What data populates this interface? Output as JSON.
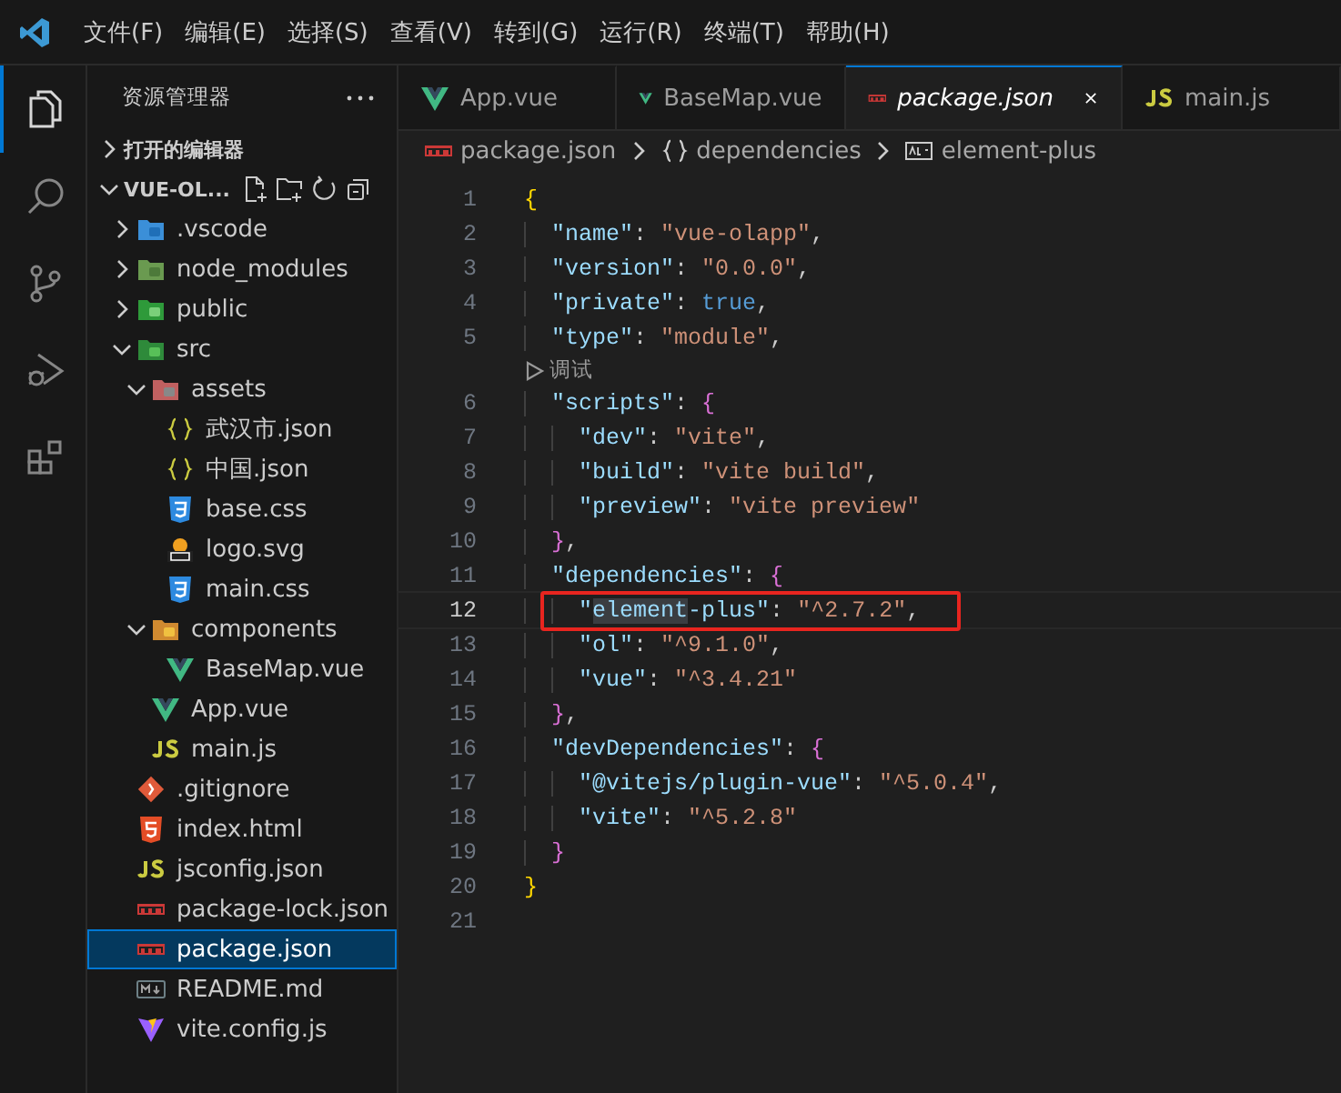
{
  "menu": [
    "文件(F)",
    "编辑(E)",
    "选择(S)",
    "查看(V)",
    "转到(G)",
    "运行(R)",
    "终端(T)",
    "帮助(H)"
  ],
  "activity_bar": [
    {
      "kind": "explorer",
      "selected": true
    },
    {
      "kind": "search",
      "selected": false
    },
    {
      "kind": "source-control",
      "selected": false
    },
    {
      "kind": "run-debug",
      "selected": false
    },
    {
      "kind": "extensions",
      "selected": false
    }
  ],
  "sidebar": {
    "title": "资源管理器",
    "sections": [
      {
        "label": "打开的编辑器",
        "expanded": false
      },
      {
        "label": "VUE-OL...",
        "expanded": true
      }
    ],
    "tree": [
      {
        "label": ".vscode",
        "kind": "folder-vscode",
        "expanded": false,
        "selected": false
      },
      {
        "label": "node_modules",
        "kind": "folder-node",
        "expanded": false,
        "selected": false
      },
      {
        "label": "public",
        "kind": "folder-public",
        "expanded": false,
        "selected": false
      },
      {
        "label": "src",
        "kind": "folder-src",
        "expanded": true,
        "selected": false,
        "children": [
          {
            "label": "assets",
            "kind": "folder-assets",
            "expanded": true,
            "selected": false,
            "children": [
              {
                "label": "武汉市.json",
                "kind": "json",
                "selected": false
              },
              {
                "label": "中国.json",
                "kind": "json",
                "selected": false
              },
              {
                "label": "base.css",
                "kind": "css",
                "selected": false
              },
              {
                "label": "logo.svg",
                "kind": "svg",
                "selected": false
              },
              {
                "label": "main.css",
                "kind": "css",
                "selected": false
              }
            ]
          },
          {
            "label": "components",
            "kind": "folder-components",
            "expanded": true,
            "selected": false,
            "children": [
              {
                "label": "BaseMap.vue",
                "kind": "vue",
                "selected": false
              }
            ]
          },
          {
            "label": "App.vue",
            "kind": "vue",
            "selected": false
          },
          {
            "label": "main.js",
            "kind": "js",
            "selected": false
          }
        ]
      },
      {
        "label": ".gitignore",
        "kind": "git",
        "selected": false
      },
      {
        "label": "index.html",
        "kind": "html",
        "selected": false
      },
      {
        "label": "jsconfig.json",
        "kind": "js",
        "selected": false
      },
      {
        "label": "package-lock.json",
        "kind": "npm",
        "selected": false
      },
      {
        "label": "package.json",
        "kind": "npm",
        "selected": true
      },
      {
        "label": "README.md",
        "kind": "md",
        "selected": false
      },
      {
        "label": "vite.config.js",
        "kind": "vite",
        "selected": false
      }
    ]
  },
  "tabs": [
    {
      "label": "App.vue",
      "kind": "vue",
      "selected": false
    },
    {
      "label": "BaseMap.vue",
      "kind": "vue",
      "selected": false
    },
    {
      "label": "package.json",
      "kind": "npm",
      "selected": true
    },
    {
      "label": "main.js",
      "kind": "js",
      "selected": false
    }
  ],
  "breadcrumb": [
    {
      "label": "package.json",
      "kind": "npm"
    },
    {
      "label": "dependencies",
      "kind": "braces"
    },
    {
      "label": "element-plus",
      "kind": "string"
    }
  ],
  "code": [
    {
      "kind": "code",
      "number": "1",
      "current": false,
      "boxed": false,
      "tokens": [
        {
          "kind": "brace1",
          "t": "{"
        }
      ]
    },
    {
      "kind": "code",
      "number": "2",
      "current": false,
      "boxed": false,
      "tokens": [
        {
          "kind": "key",
          "t": "  \"name\""
        },
        {
          "kind": "punc",
          "t": ": "
        },
        {
          "kind": "str",
          "t": "\"vue-olapp\""
        },
        {
          "kind": "punc",
          "t": ","
        }
      ]
    },
    {
      "kind": "code",
      "number": "3",
      "current": false,
      "boxed": false,
      "tokens": [
        {
          "kind": "key",
          "t": "  \"version\""
        },
        {
          "kind": "punc",
          "t": ": "
        },
        {
          "kind": "str",
          "t": "\"0.0.0\""
        },
        {
          "kind": "punc",
          "t": ","
        }
      ]
    },
    {
      "kind": "code",
      "number": "4",
      "current": false,
      "boxed": false,
      "tokens": [
        {
          "kind": "key",
          "t": "  \"private\""
        },
        {
          "kind": "punc",
          "t": ": "
        },
        {
          "kind": "bool",
          "t": "true"
        },
        {
          "kind": "punc",
          "t": ","
        }
      ]
    },
    {
      "kind": "code",
      "number": "5",
      "current": false,
      "boxed": false,
      "tokens": [
        {
          "kind": "key",
          "t": "  \"type\""
        },
        {
          "kind": "punc",
          "t": ": "
        },
        {
          "kind": "str",
          "t": "\"module\""
        },
        {
          "kind": "punc",
          "t": ","
        }
      ]
    },
    {
      "kind": "codelens",
      "label": "调试"
    },
    {
      "kind": "code",
      "number": "6",
      "current": false,
      "boxed": false,
      "tokens": [
        {
          "kind": "key",
          "t": "  \"scripts\""
        },
        {
          "kind": "punc",
          "t": ": "
        },
        {
          "kind": "brace2",
          "t": "{"
        }
      ]
    },
    {
      "kind": "code",
      "number": "7",
      "current": false,
      "boxed": false,
      "tokens": [
        {
          "kind": "key",
          "t": "    \"dev\""
        },
        {
          "kind": "punc",
          "t": ": "
        },
        {
          "kind": "str",
          "t": "\"vite\""
        },
        {
          "kind": "punc",
          "t": ","
        }
      ]
    },
    {
      "kind": "code",
      "number": "8",
      "current": false,
      "boxed": false,
      "tokens": [
        {
          "kind": "key",
          "t": "    \"build\""
        },
        {
          "kind": "punc",
          "t": ": "
        },
        {
          "kind": "str",
          "t": "\"vite build\""
        },
        {
          "kind": "punc",
          "t": ","
        }
      ]
    },
    {
      "kind": "code",
      "number": "9",
      "current": false,
      "boxed": false,
      "tokens": [
        {
          "kind": "key",
          "t": "    \"preview\""
        },
        {
          "kind": "punc",
          "t": ": "
        },
        {
          "kind": "str",
          "t": "\"vite preview\""
        }
      ]
    },
    {
      "kind": "code",
      "number": "10",
      "current": false,
      "boxed": false,
      "tokens": [
        {
          "kind": "brace2",
          "t": "  }"
        },
        {
          "kind": "punc",
          "t": ","
        }
      ]
    },
    {
      "kind": "code",
      "number": "11",
      "current": false,
      "boxed": false,
      "tokens": [
        {
          "kind": "key",
          "t": "  \"dependencies\""
        },
        {
          "kind": "punc",
          "t": ": "
        },
        {
          "kind": "brace2",
          "t": "{"
        }
      ]
    },
    {
      "kind": "code",
      "number": "12",
      "current": true,
      "boxed": true,
      "tokens": [
        {
          "kind": "key",
          "t": "    \""
        },
        {
          "kind": "key-match",
          "t": "element"
        },
        {
          "kind": "key",
          "t": "-plus\""
        },
        {
          "kind": "punc",
          "t": ": "
        },
        {
          "kind": "str",
          "t": "\"^2.7.2\""
        },
        {
          "kind": "punc",
          "t": ","
        }
      ]
    },
    {
      "kind": "code",
      "number": "13",
      "current": false,
      "boxed": false,
      "tokens": [
        {
          "kind": "key",
          "t": "    \"ol\""
        },
        {
          "kind": "punc",
          "t": ": "
        },
        {
          "kind": "str",
          "t": "\"^9.1.0\""
        },
        {
          "kind": "punc",
          "t": ","
        }
      ]
    },
    {
      "kind": "code",
      "number": "14",
      "current": false,
      "boxed": false,
      "tokens": [
        {
          "kind": "key",
          "t": "    \"vue\""
        },
        {
          "kind": "punc",
          "t": ": "
        },
        {
          "kind": "str",
          "t": "\"^3.4.21\""
        }
      ]
    },
    {
      "kind": "code",
      "number": "15",
      "current": false,
      "boxed": false,
      "tokens": [
        {
          "kind": "brace2",
          "t": "  }"
        },
        {
          "kind": "punc",
          "t": ","
        }
      ]
    },
    {
      "kind": "code",
      "number": "16",
      "current": false,
      "boxed": false,
      "tokens": [
        {
          "kind": "key",
          "t": "  \"devDependencies\""
        },
        {
          "kind": "punc",
          "t": ": "
        },
        {
          "kind": "brace2",
          "t": "{"
        }
      ]
    },
    {
      "kind": "code",
      "number": "17",
      "current": false,
      "boxed": false,
      "tokens": [
        {
          "kind": "key",
          "t": "    \"@vitejs/plugin-vue\""
        },
        {
          "kind": "punc",
          "t": ": "
        },
        {
          "kind": "str",
          "t": "\"^5.0.4\""
        },
        {
          "kind": "punc",
          "t": ","
        }
      ]
    },
    {
      "kind": "code",
      "number": "18",
      "current": false,
      "boxed": false,
      "tokens": [
        {
          "kind": "key",
          "t": "    \"vite\""
        },
        {
          "kind": "punc",
          "t": ": "
        },
        {
          "kind": "str",
          "t": "\"^5.2.8\""
        }
      ]
    },
    {
      "kind": "code",
      "number": "19",
      "current": false,
      "boxed": false,
      "tokens": [
        {
          "kind": "brace2",
          "t": "  }"
        }
      ]
    },
    {
      "kind": "code",
      "number": "20",
      "current": false,
      "boxed": false,
      "tokens": [
        {
          "kind": "brace1",
          "t": "}"
        }
      ]
    },
    {
      "kind": "code",
      "number": "21",
      "current": false,
      "boxed": false
    }
  ]
}
